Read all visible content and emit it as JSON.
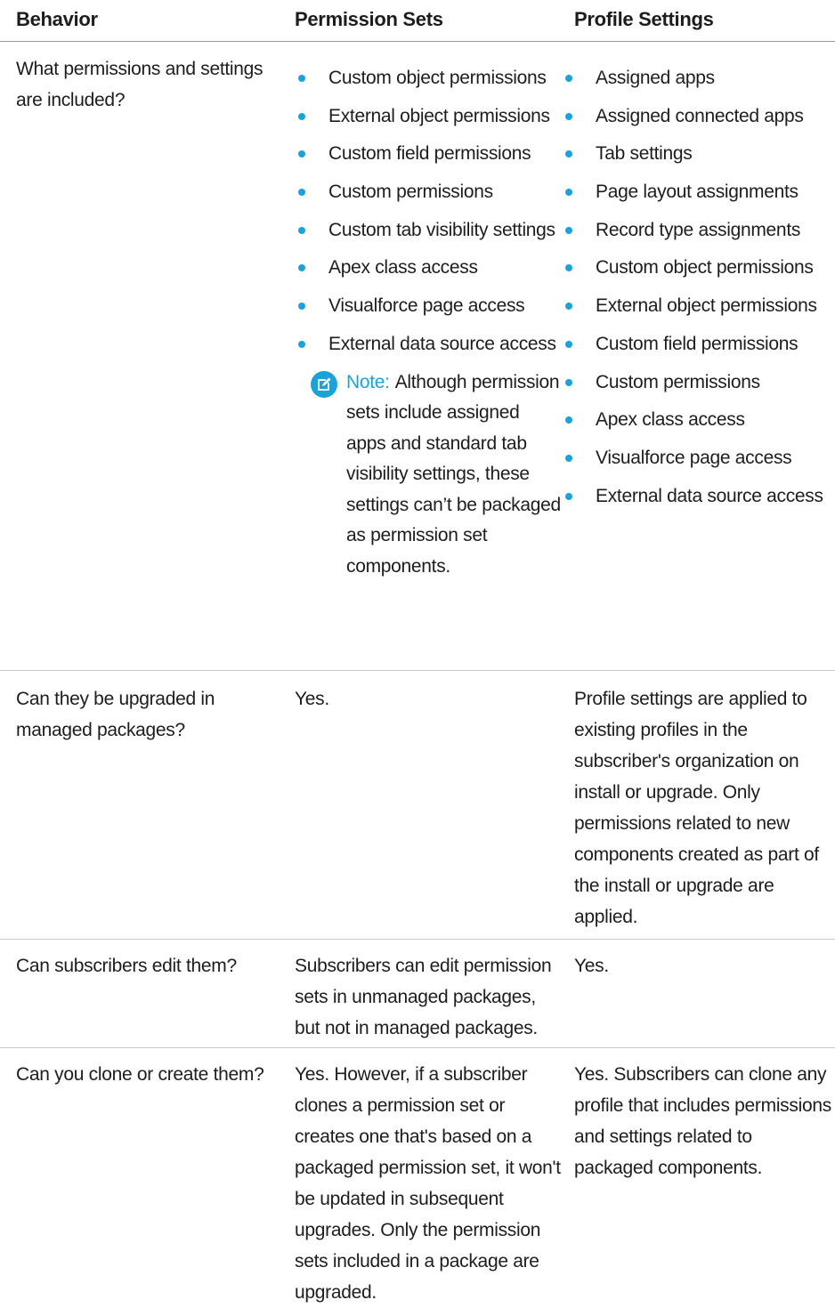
{
  "headers": {
    "behavior": "Behavior",
    "permission_sets": "Permission Sets",
    "profile_settings": "Profile Settings"
  },
  "rows": [
    {
      "behavior": "What permissions and settings are included?",
      "permission_sets_items": [
        "Custom object permissions",
        "External object permissions",
        "Custom field permissions",
        "Custom permissions",
        "Custom tab visibility settings",
        "Apex class access",
        "Visualforce page access",
        "External data source access"
      ],
      "note_label": "Note:",
      "note_text": "Although permission sets include assigned apps and standard tab visibility settings, these settings can’t be packaged as permission set components.",
      "profile_settings_items": [
        "Assigned apps",
        "Assigned connected apps",
        "Tab settings",
        "Page layout assignments",
        "Record type assignments",
        "Custom object permissions",
        "External object permissions",
        "Custom field permissions",
        "Custom permissions",
        "Apex class access",
        "Visualforce page access",
        "External data source access"
      ]
    },
    {
      "behavior": "Can they be upgraded in managed packages?",
      "permission_sets": "Yes.",
      "profile_settings": "Profile settings are applied to existing profiles in the subscriber's organization on install or upgrade. Only permissions related to new components created as part of the install or upgrade are applied."
    },
    {
      "behavior": "Can subscribers edit them?",
      "permission_sets": "Subscribers can edit permission sets in unmanaged packages, but not in managed packages.",
      "profile_settings": "Yes."
    },
    {
      "behavior": "Can you clone or create them?",
      "permission_sets": "Yes. However, if a subscriber clones a permission set or creates one that's based on a packaged permission set, it won't be updated in subsequent upgrades. Only the permission sets included in a package are upgraded.",
      "profile_settings": "Yes. Subscribers can clone any profile that includes permissions and settings related to packaged components."
    }
  ],
  "colors": {
    "accent": "#1aa3db",
    "text": "#1d1d1d",
    "rule": "#c8c8c8"
  },
  "icons": {
    "bullet": "bullet-dot",
    "note": "edit-note-icon"
  }
}
